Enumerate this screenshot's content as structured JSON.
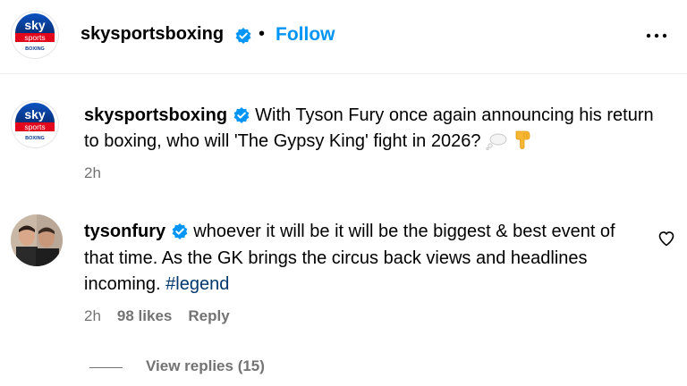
{
  "header": {
    "username": "skysportsboxing",
    "separator": "•",
    "follow_label": "Follow"
  },
  "caption": {
    "username": "skysportsboxing",
    "text": "With Tyson Fury once again announcing his return to boxing, who will 'The Gypsy King' fight in 2026?",
    "time": "2h"
  },
  "comment": {
    "username": "tysonfury",
    "text": "whoever it will be it will be the biggest & best event of that time. As the GK brings the circus back views and headlines incoming.",
    "hashtag": "#legend",
    "time": "2h",
    "likes": "98 likes",
    "reply_label": "Reply"
  },
  "replies": {
    "label": "View replies (15)"
  },
  "logo": {
    "line1": "sky",
    "line2": "sports",
    "line3": "BOXING"
  },
  "colors": {
    "accent": "#0095f6",
    "verified": "#0095f6",
    "muted": "#737373",
    "hashtag": "#00376b",
    "sky_red": "#e1061b",
    "sky_blue": "#0a3a8c"
  },
  "icons": {
    "verified": "verified-badge-icon",
    "more": "more-options-icon",
    "like": "heart-icon",
    "thought": "thought-bubble-emoji",
    "pointing": "pointing-down-emoji"
  }
}
